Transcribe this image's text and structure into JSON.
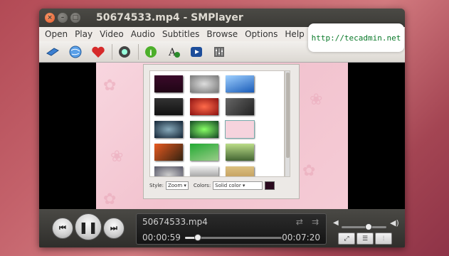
{
  "window": {
    "title": "50674533.mp4 - SMPlayer"
  },
  "menu": {
    "items": [
      {
        "label": "Open"
      },
      {
        "label": "Play"
      },
      {
        "label": "Video"
      },
      {
        "label": "Audio"
      },
      {
        "label": "Subtitles"
      },
      {
        "label": "Browse"
      },
      {
        "label": "Options"
      },
      {
        "label": "Help"
      }
    ]
  },
  "toolbar": {
    "icons": [
      "playlist-icon",
      "web-icon",
      "favorites-icon",
      "screenshot-icon",
      "info-icon",
      "subtitle-download-icon",
      "video-filter-icon",
      "equalizer-icon"
    ]
  },
  "dialog": {
    "style_label": "Style:",
    "style_value": "Zoom",
    "colors_label": "Colors:",
    "colors_value": "Solid color",
    "swatch_color": "#2a0a1e"
  },
  "player": {
    "filename": "50674533.mp4",
    "elapsed": "00:00:59",
    "total": "00:07:20",
    "progress": 0.13,
    "volume": 0.6
  },
  "watermark": {
    "text": "http://tecadmin.net"
  },
  "colors": {
    "accent": "#e4572a",
    "window_bg": "#3c3b37",
    "watermark_text": "#0a7a2a"
  }
}
